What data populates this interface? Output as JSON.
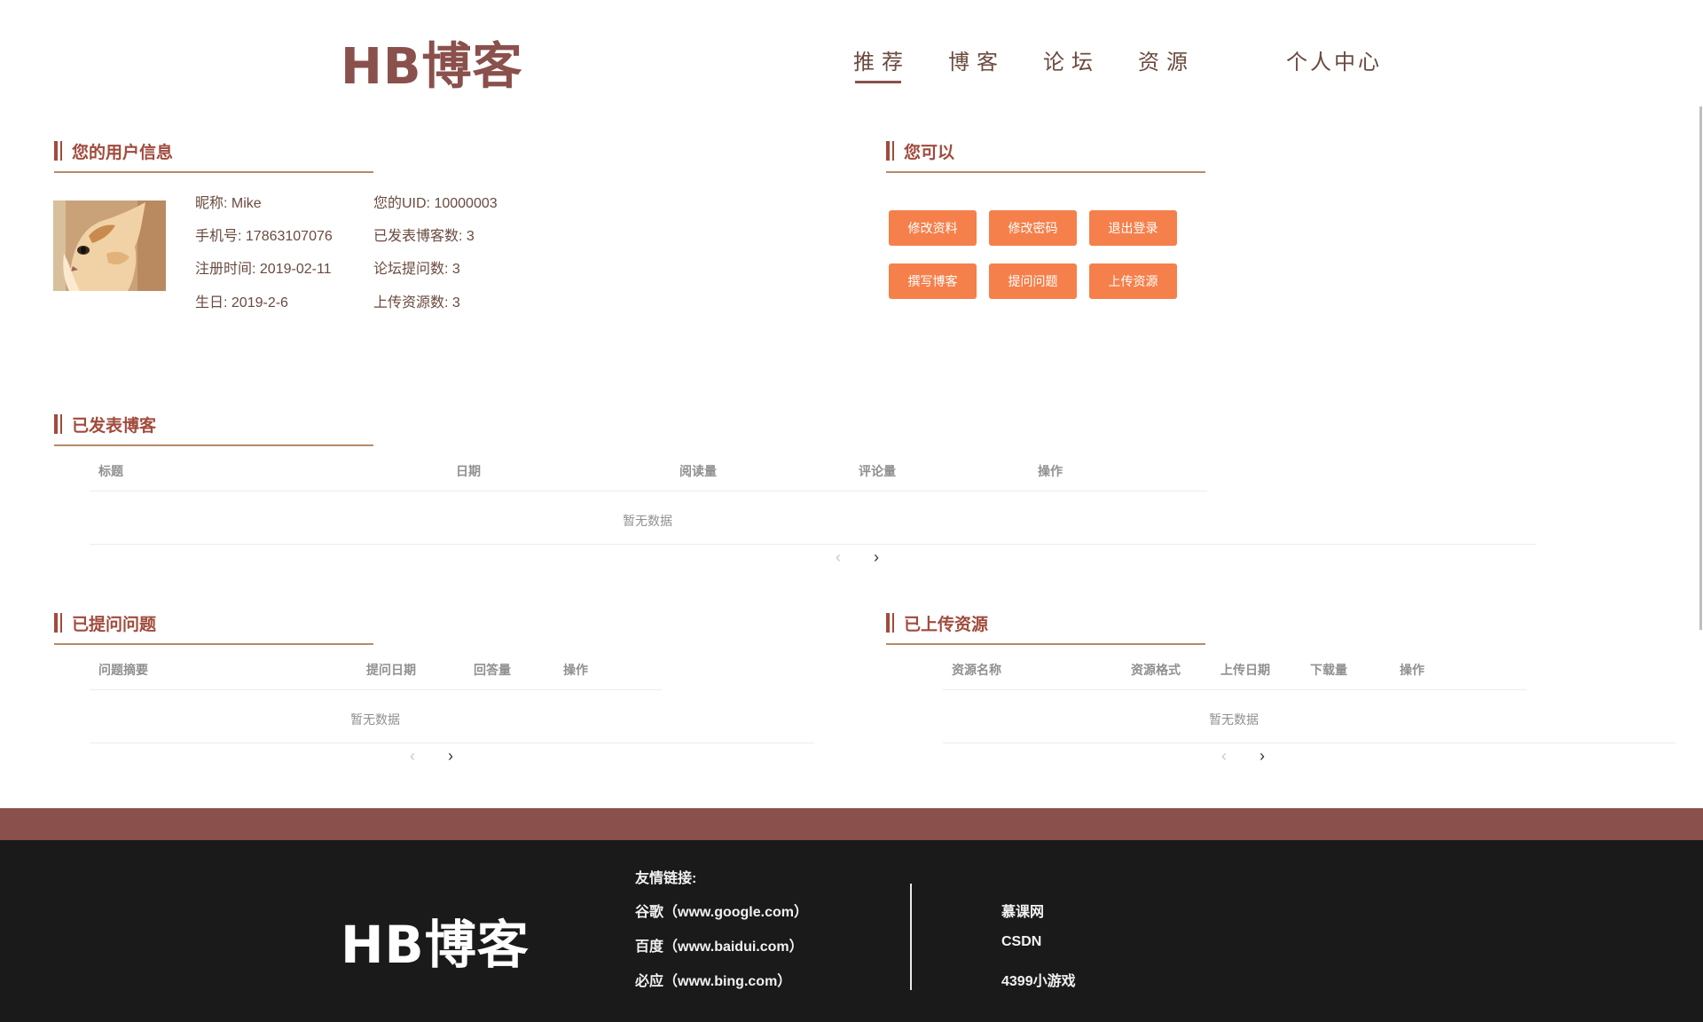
{
  "header": {
    "logo": "HB博客",
    "nav": [
      "推荐",
      "博客",
      "论坛",
      "资源"
    ],
    "personal": "个人中心"
  },
  "user_info": {
    "title": "您的用户信息",
    "nickname": "昵称: Mike",
    "phone": "手机号: 17863107076",
    "register": "注册时间: 2019-02-11",
    "birthday": "生日: 2019-2-6",
    "uid": "您的UID: 10000003",
    "blogs": "已发表博客数: 3",
    "questions": "论坛提问数: 3",
    "resources": "上传资源数: 3"
  },
  "actions": {
    "title": "您可以",
    "buttons": [
      "修改资料",
      "修改密码",
      "退出登录",
      "撰写博客",
      "提问问题",
      "上传资源"
    ]
  },
  "blogs": {
    "title": "已发表博客",
    "columns": [
      "标题",
      "日期",
      "阅读量",
      "评论量",
      "操作"
    ],
    "empty": "暂无数据"
  },
  "questions": {
    "title": "已提问问题",
    "columns": [
      "问题摘要",
      "提问日期",
      "回答量",
      "操作"
    ],
    "empty": "暂无数据"
  },
  "resources": {
    "title": "已上传资源",
    "columns": [
      "资源名称",
      "资源格式",
      "上传日期",
      "下载量",
      "操作"
    ],
    "empty": "暂无数据"
  },
  "pagination": {
    "prev": "‹",
    "next": "›"
  },
  "footer": {
    "logo": "HB博客",
    "links_title": "友情链接:",
    "links": [
      "谷歌（www.google.com）",
      "百度（www.baidui.com）",
      "必应（www.bing.com）"
    ],
    "links2": [
      "慕课网",
      "CSDN",
      "4399小游戏"
    ]
  },
  "colors": {
    "brand": "#8a504c",
    "accent": "#a04b3d",
    "button": "#f5804b",
    "footer_bg": "#1b1a1a"
  }
}
